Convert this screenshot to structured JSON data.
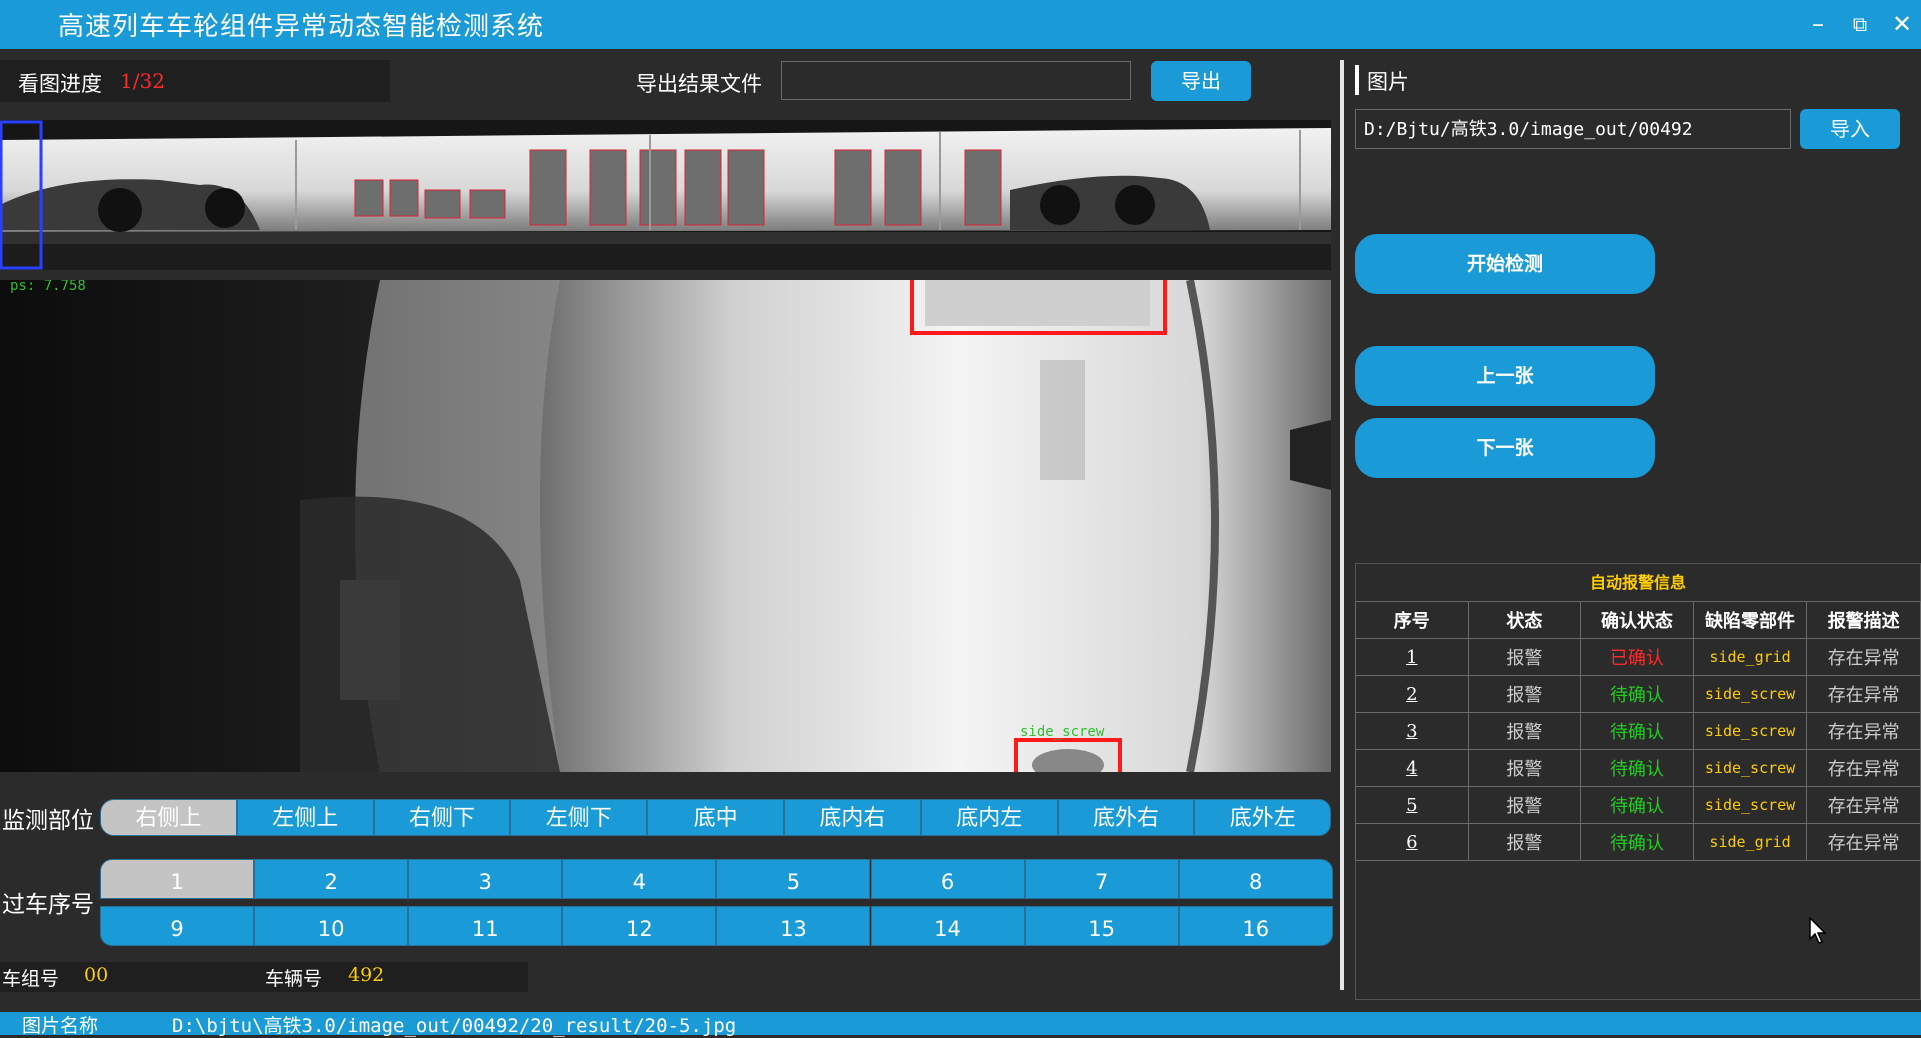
{
  "title": "高速列车车轮组件异常动态智能检测系统",
  "window_controls": {
    "minimize": "–",
    "restore": "⧉",
    "close": "✕"
  },
  "progress": {
    "label": "看图进度",
    "value": "1/32"
  },
  "export": {
    "label": "导出结果文件",
    "value": "",
    "button": "导出"
  },
  "picture_panel": {
    "label": "图片",
    "path": "D:/Bjtu/高铁3.0/image_out/00492",
    "import_button": "导入"
  },
  "actions": {
    "start": "开始检测",
    "prev": "上一张",
    "next": "下一张"
  },
  "alert": {
    "title": "自动报警信息",
    "headers": [
      "序号",
      "状态",
      "确认状态",
      "缺陷零部件",
      "报警描述"
    ],
    "rows": [
      {
        "idx": "1",
        "status": "报警",
        "confirm": "已确认",
        "confirm_state": "confirmed",
        "part": "side_grid",
        "desc": "存在异常"
      },
      {
        "idx": "2",
        "status": "报警",
        "confirm": "待确认",
        "confirm_state": "pending",
        "part": "side_screw",
        "desc": "存在异常"
      },
      {
        "idx": "3",
        "status": "报警",
        "confirm": "待确认",
        "confirm_state": "pending",
        "part": "side_screw",
        "desc": "存在异常"
      },
      {
        "idx": "4",
        "status": "报警",
        "confirm": "待确认",
        "confirm_state": "pending",
        "part": "side_screw",
        "desc": "存在异常"
      },
      {
        "idx": "5",
        "status": "报警",
        "confirm": "待确认",
        "confirm_state": "pending",
        "part": "side_screw",
        "desc": "存在异常"
      },
      {
        "idx": "6",
        "status": "报警",
        "confirm": "待确认",
        "confirm_state": "pending",
        "part": "side_grid",
        "desc": "存在异常"
      }
    ]
  },
  "monitor": {
    "label": "监测部位",
    "positions": [
      "右侧上",
      "左侧上",
      "右侧下",
      "左侧下",
      "底中",
      "底内右",
      "底内左",
      "底外右",
      "底外左"
    ],
    "active_index": 0
  },
  "pass_seq": {
    "label": "过车序号",
    "numbers": [
      "1",
      "2",
      "3",
      "4",
      "5",
      "6",
      "7",
      "8",
      "9",
      "10",
      "11",
      "12",
      "13",
      "14",
      "15",
      "16"
    ],
    "active_index": 0
  },
  "info": {
    "group_label": "车组号",
    "group_value": "00",
    "vehicle_label": "车辆号",
    "vehicle_value": "492"
  },
  "status": {
    "label": "图片名称",
    "value": "D:\\bjtu\\高铁3.0/image_out/00492/20_result/20-5.jpg"
  },
  "image_overlay": {
    "top_text": "ps: 7.758",
    "det_label": "side_screw"
  },
  "colors": {
    "accent": "#1a9ad6",
    "alarm": "#ff2b2b",
    "pending": "#22cc22",
    "highlight": "#ffcc00",
    "bg": "#2b2b2b"
  },
  "icons": [
    "minimize-icon",
    "restore-icon",
    "close-icon",
    "cursor-icon"
  ]
}
